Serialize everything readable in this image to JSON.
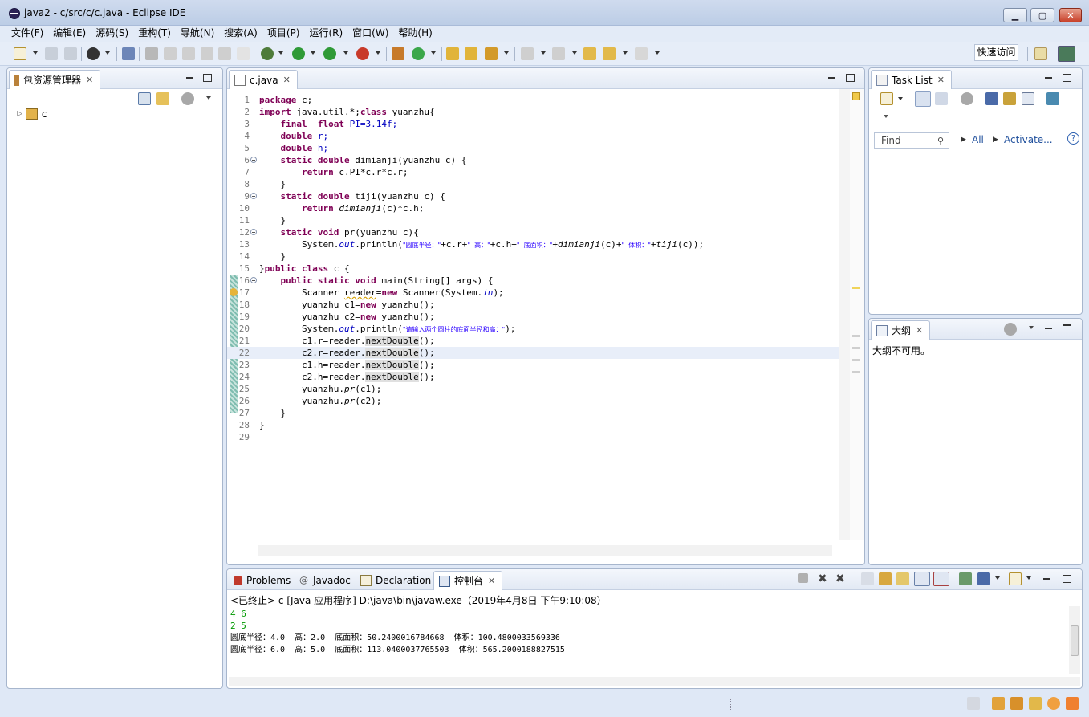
{
  "window": {
    "title": "java2 - c/src/c/c.java - Eclipse IDE"
  },
  "menu": [
    "文件(F)",
    "编辑(E)",
    "源码(S)",
    "重构(T)",
    "导航(N)",
    "搜索(A)",
    "项目(P)",
    "运行(R)",
    "窗口(W)",
    "帮助(H)"
  ],
  "toolbar": {
    "quick_access": "快速访问"
  },
  "package_explorer": {
    "tab_label": "包资源管理器",
    "tree": [
      {
        "label": "c"
      }
    ]
  },
  "editor": {
    "tab_label": "c.java",
    "lines": [
      "1",
      "2",
      "3",
      "4",
      "5",
      "6",
      "7",
      "8",
      "9",
      "10",
      "11",
      "12",
      "13",
      "14",
      "15",
      "16",
      "17",
      "18",
      "19",
      "20",
      "21",
      "22",
      "23",
      "24",
      "25",
      "26",
      "27",
      "28",
      "29"
    ],
    "code": {
      "l1": "c;",
      "l2a": "java.util.*;",
      "l2b": "yuanzhu{",
      "l3a": "PI=3.14f;",
      "l4": "r;",
      "l5": "h;",
      "l6": "dimianji(yuanzhu c) {",
      "l7a": "c.PI*c.r*c.r;",
      "l9": "tiji(yuanzhu c) {",
      "l10a": "dimianji",
      "l10b": "(c)*c.h;",
      "l12": "pr(yuanzhu c){",
      "l13_pre": "System.",
      "l13_out": "out",
      "l13_mid": ".println(",
      "l13_s1": "\"圆底半径：\"",
      "l13_c1": "+c.r+",
      "l13_s2": "\"  高：\"",
      "l13_c2": "+c.h+",
      "l13_s3": "\"  底面积：\"",
      "l13_c3": "+",
      "l13_f1": "dimianji",
      "l13_c4": "(c)+",
      "l13_s4": "\"  体积：\"",
      "l13_c5": "+",
      "l13_f2": "tiji",
      "l13_c6": "(c));",
      "l15": "c {",
      "l16": "main(String[] args) {",
      "l17a": "Scanner ",
      "l17b": "reader",
      "l17c": "=",
      "l17d": " Scanner(System.",
      "l17e": "in",
      "l17f": ");",
      "l18": "yuanzhu c1=",
      "l18b": " yuanzhu();",
      "l19": "yuanzhu c2=",
      "l19b": " yuanzhu();",
      "l20_pre": "System.",
      "l20_out": "out",
      "l20_mid": ".println(",
      "l20_s": "\"请输入两个圆柱的底面半径和高：\"",
      "l20_end": ");",
      "l21a": "c1.r=reader.",
      "l22a": "c2.r=reader.",
      "l23a": "c1.h=reader.",
      "l24a": "c2.h=reader.",
      "next": "nextDouble",
      "call_end": "();",
      "l25a": "yuanzhu.",
      "pr": "pr",
      "l25b": "(c1);",
      "l26b": "(c2);",
      "brace_close": "}",
      "brace_close_cls": "}"
    }
  },
  "task_list": {
    "tab_label": "Task List",
    "find_placeholder": "Find",
    "all_link": "All",
    "activate_link": "Activate..."
  },
  "outline": {
    "tab_label": "大纲",
    "message": "大纲不可用。"
  },
  "bottom": {
    "tabs": [
      "Problems",
      "Javadoc",
      "Declaration",
      "控制台"
    ],
    "status_line": "<已终止> c [Java 应用程序] D:\\java\\bin\\javaw.exe（2019年4月8日 下午9:10:08）",
    "output": [
      {
        "text": "4 6",
        "kind": "in"
      },
      {
        "text": "2 5",
        "kind": "in"
      },
      {
        "text": "圆底半径：4.0  高：2.0  底面积：50.2400016784668  体积：100.4800033569336",
        "kind": "out"
      },
      {
        "text": "圆底半径：6.0  高：5.0  底面积：113.0400037765503  体积：565.2000188827515",
        "kind": "out"
      }
    ]
  },
  "icons": {
    "app": "eclipse-icon",
    "package": "package-explorer-icon",
    "java_file": "java-file-icon",
    "tasks": "task-list-icon",
    "outline": "outline-icon",
    "console": "console-icon"
  }
}
